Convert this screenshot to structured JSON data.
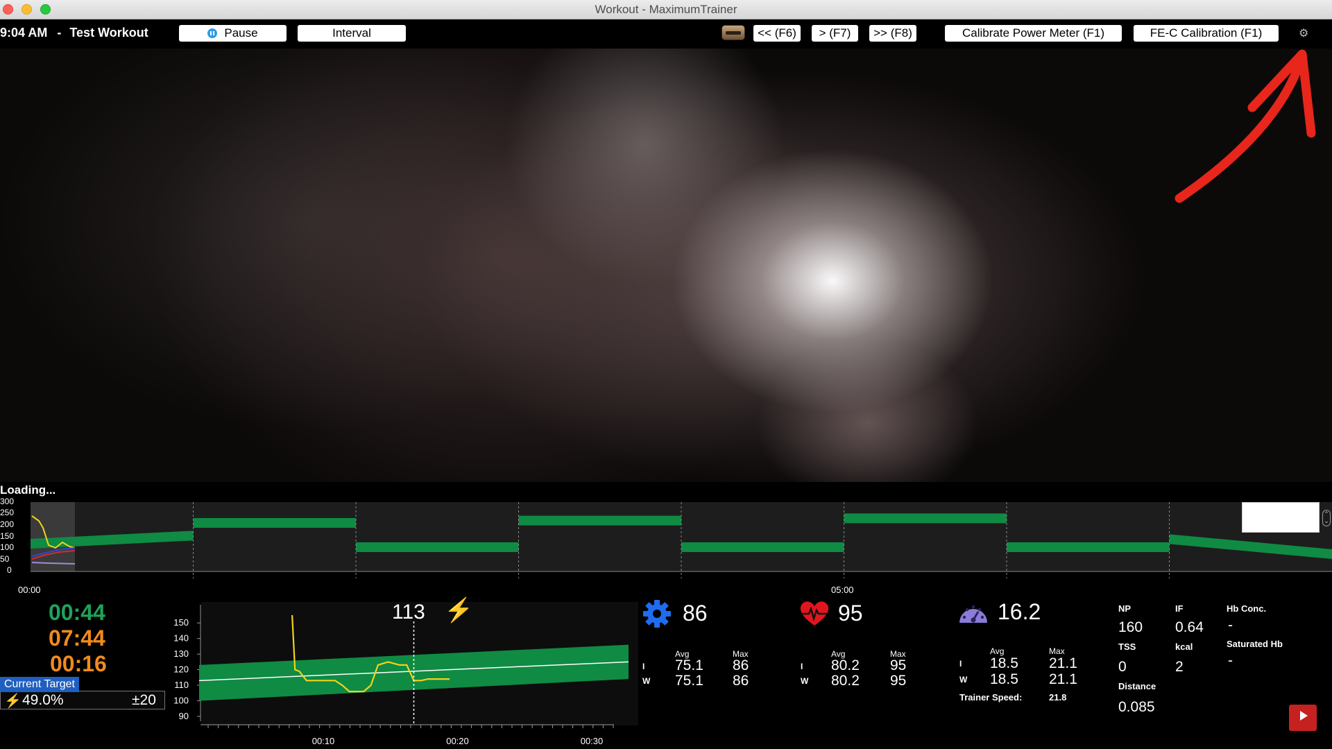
{
  "window": {
    "title": "Workout - MaximumTrainer"
  },
  "toolbar": {
    "time": "9:04 AM",
    "separator": "-",
    "workout_name": "Test Workout",
    "pause_label": "Pause",
    "interval_label": "Interval",
    "prev_label": "<< (F6)",
    "play_label": "> (F7)",
    "next_label": ">> (F8)",
    "calibrate_label": "Calibrate Power Meter (F1)",
    "fec_label": "FE-C Calibration (F1)"
  },
  "status": {
    "loading": "Loading..."
  },
  "overview": {
    "y_ticks": [
      "300",
      "250",
      "200",
      "150",
      "100",
      "50",
      "0"
    ],
    "x_ticks": [
      "00:00",
      "05:00"
    ],
    "intervals": [
      {
        "start": 0,
        "end": 1,
        "from": 120,
        "to": 155
      },
      {
        "start": 1,
        "end": 2,
        "from": 210,
        "to": 210
      },
      {
        "start": 2,
        "end": 3,
        "from": 105,
        "to": 105
      },
      {
        "start": 3,
        "end": 4,
        "from": 220,
        "to": 220
      },
      {
        "start": 4,
        "end": 5,
        "from": 105,
        "to": 105
      },
      {
        "start": 5,
        "end": 6,
        "from": 230,
        "to": 230
      },
      {
        "start": 6,
        "end": 7,
        "from": 105,
        "to": 105
      },
      {
        "start": 7,
        "end": 8,
        "from": 140,
        "to": 75
      }
    ]
  },
  "timers": {
    "elapsed": "00:44",
    "remaining": "07:44",
    "interval": "00:16"
  },
  "target": {
    "label": "Current Target",
    "percent": "49.0%",
    "tolerance": "±20"
  },
  "power": {
    "current": "113"
  },
  "chart_data": {
    "type": "line",
    "y_ticks": [
      "150",
      "140",
      "130",
      "120",
      "110",
      "100",
      "90"
    ],
    "x_ticks": [
      "00:10",
      "00:20",
      "00:30"
    ],
    "ylim": [
      90,
      155
    ],
    "xlim": [
      0,
      30
    ],
    "target_band": {
      "x": [
        0,
        30
      ],
      "low": [
        100,
        114
      ],
      "high": [
        123,
        136
      ]
    },
    "target_line": {
      "x": [
        0,
        30
      ],
      "y": [
        113,
        125
      ]
    },
    "now_x": 15,
    "series": [
      {
        "x": [
          6.5,
          6.7,
          7.0,
          7.5,
          8.0,
          9.5,
          10.0,
          10.5,
          11.5,
          12.0,
          12.5,
          13.2,
          14.0,
          14.5,
          15.0,
          15.5,
          16.0,
          16.5,
          17.5
        ],
        "y": [
          155,
          120,
          119,
          113,
          113,
          113,
          110,
          106,
          106,
          110,
          123,
          125,
          123,
          123,
          113,
          113,
          114,
          114,
          114
        ]
      }
    ]
  },
  "cadence": {
    "current": "86",
    "avg_label": "Avg",
    "max_label": "Max",
    "row1_label": "I",
    "row2_label": "W",
    "i_avg": "75.1",
    "i_max": "86",
    "w_avg": "75.1",
    "w_max": "86"
  },
  "heart_rate": {
    "current": "95",
    "avg_label": "Avg",
    "max_label": "Max",
    "row1_label": "I",
    "row2_label": "W",
    "i_avg": "80.2",
    "i_max": "95",
    "w_avg": "80.2",
    "w_max": "95"
  },
  "speed": {
    "current": "16.2",
    "avg_label": "Avg",
    "max_label": "Max",
    "row1_label": "I",
    "row2_label": "W",
    "i_avg": "18.5",
    "i_max": "21.1",
    "w_avg": "18.5",
    "w_max": "21.1",
    "trainer_speed_label": "Trainer Speed:",
    "trainer_speed": "21.8"
  },
  "summary": {
    "np_label": "NP",
    "np": "160",
    "if_label": "IF",
    "if": "0.64",
    "tss_label": "TSS",
    "tss": "0",
    "kcal_label": "kcal",
    "kcal": "2",
    "distance_label": "Distance",
    "distance": "0.085",
    "hb_conc_label": "Hb Conc.",
    "hb_conc": "-",
    "sat_hb_label": "Saturated Hb",
    "sat_hb": "-"
  },
  "colors": {
    "green": "#0f8b43",
    "yellow": "#f2d41b",
    "orange": "#f08b1c",
    "timer_green": "#1ea35b",
    "arrow": "#e8261c"
  }
}
